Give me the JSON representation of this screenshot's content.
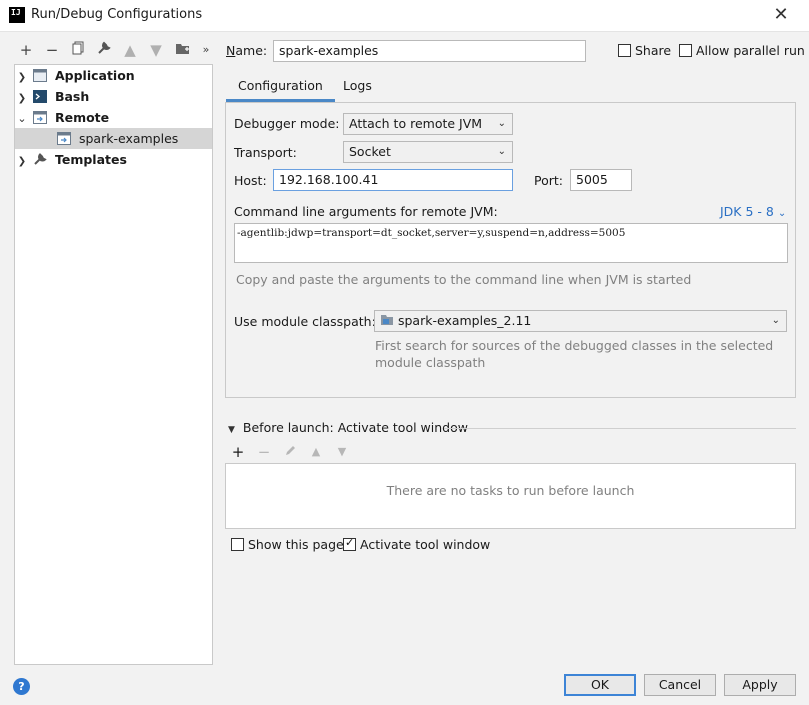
{
  "window": {
    "title": "Run/Debug Configurations",
    "close_glyph": "✕",
    "app_icon_text": "IJ"
  },
  "toolbar": {
    "icons": [
      "add-icon",
      "remove-icon",
      "copy-icon",
      "wrench-icon",
      "move-up-icon",
      "move-down-icon",
      "folder-icon",
      "more-icon"
    ]
  },
  "tree": {
    "items": [
      {
        "label": "Application",
        "expanded": false,
        "icon": "application-icon",
        "bold": true
      },
      {
        "label": "Bash",
        "expanded": false,
        "icon": "bash-icon",
        "bold": true
      },
      {
        "label": "Remote",
        "expanded": true,
        "icon": "remote-icon",
        "bold": true
      },
      {
        "label": "spark-examples",
        "child": true,
        "selected": true,
        "icon": "remote-config-icon"
      },
      {
        "label": "Templates",
        "expanded": false,
        "icon": "wrench-icon",
        "bold": true
      }
    ]
  },
  "form": {
    "name_label": "Name:",
    "name_value": "spark-examples",
    "share_label": "Share",
    "parallel_label": "Allow parallel run",
    "tabs": [
      "Configuration",
      "Logs"
    ],
    "debugger_mode_label": "Debugger mode:",
    "debugger_mode_value": "Attach to remote JVM",
    "transport_label": "Transport:",
    "transport_value": "Socket",
    "host_label": "Host:",
    "host_value": "192.168.100.41",
    "port_label": "Port:",
    "port_value": "5005",
    "cmd_label": "Command line arguments for remote JVM:",
    "jdk_link": "JDK 5 - 8",
    "cmd_value": "-agentlib:jdwp=transport=dt_socket,server=y,suspend=n,address=5005",
    "cmd_hint": "Copy and paste the arguments to the command line when JVM is started",
    "classpath_label": "Use module classpath:",
    "classpath_value": "spark-examples_2.11",
    "classpath_hint_1": "First search for sources of the debugged classes in the selected",
    "classpath_hint_2": "module classpath"
  },
  "before_launch": {
    "title": "Before launch: Activate tool window",
    "empty_text": "There are no tasks to run before launch",
    "show_page_label": "Show this page",
    "activate_label": "Activate tool window",
    "show_page_checked": false,
    "activate_checked": true
  },
  "buttons": {
    "ok": "OK",
    "cancel": "Cancel",
    "apply": "Apply",
    "help": "?"
  },
  "colors": {
    "accent": "#4a88c7",
    "link": "#2a6fc4",
    "selection": "#d5d5d5",
    "help": "#2f78d0"
  }
}
